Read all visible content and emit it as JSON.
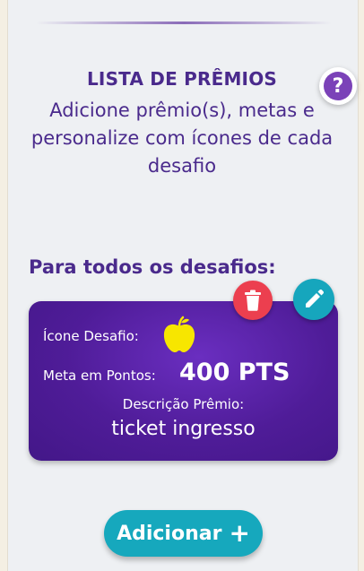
{
  "header": {
    "title": "LISTA DE PRÊMIOS",
    "subtitle": "Adicione prêmio(s), metas e personalize com ícones de cada desafio"
  },
  "help": {
    "label": "?"
  },
  "section": {
    "title": "Para todos os desafios:"
  },
  "prize_card": {
    "icon_label": "Ícone Desafio:",
    "icon_name": "apple-icon",
    "goal_label": "Meta em Pontos:",
    "goal_value": "400 PTS",
    "description_label": "Descrição Prêmio:",
    "description_value": "ticket ingresso"
  },
  "actions": {
    "delete_icon": "trash-icon",
    "edit_icon": "pencil-icon",
    "add_label": "Adicionar",
    "add_symbol": "+"
  },
  "colors": {
    "primary_purple": "#4a2a8c",
    "card_purple": "#4f1c98",
    "delete_red": "#ec3f4f",
    "accent_teal": "#16a6bd",
    "apple_yellow": "#f7e600"
  }
}
